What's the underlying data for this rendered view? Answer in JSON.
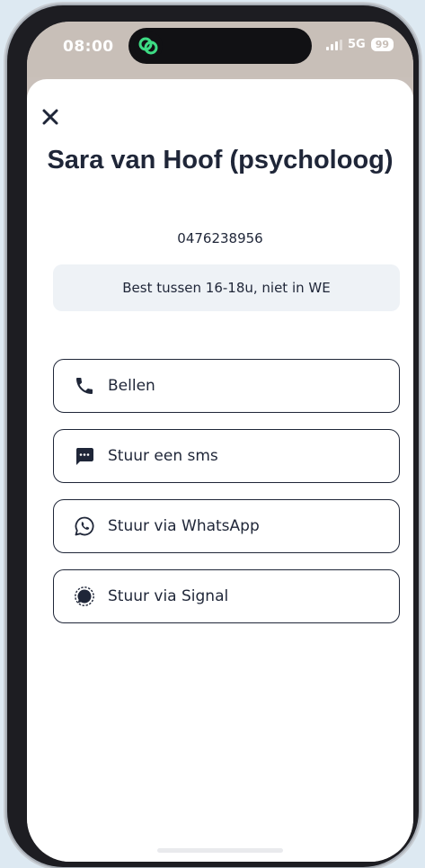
{
  "status_bar": {
    "time": "08:00",
    "network": "5G",
    "battery": "99"
  },
  "contact": {
    "name": "Sara van Hoof (psycholoog)",
    "phone": "0476238956",
    "note": "Best tussen 16-18u, niet in WE"
  },
  "actions": [
    {
      "label": "Bellen",
      "icon": "phone-icon"
    },
    {
      "label": "Stuur een sms",
      "icon": "sms-icon"
    },
    {
      "label": "Stuur via WhatsApp",
      "icon": "whatsapp-icon"
    },
    {
      "label": "Stuur via Signal",
      "icon": "signal-icon"
    }
  ],
  "colors": {
    "text": "#1f2638",
    "note_background": "#eef2f6",
    "status_bar": "#c8bfb8",
    "app_logo": "#3ddc84"
  }
}
